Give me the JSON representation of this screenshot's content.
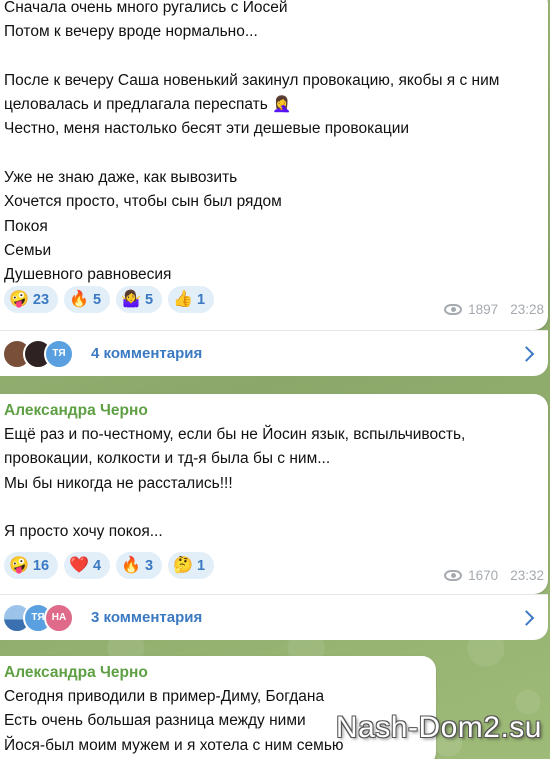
{
  "messages": [
    {
      "text": "Сначала очень много ругались с Йосей\nПотом к вечеру вроде нормально...\n\nПосле к вечеру Саша новенький закинул провокацию, якобы я с ним целовалась и предлагала переспать 🤦‍♀️\nЧестно, меня настолько бесят эти дешевые провокации\n\nУже не знаю даже, как вывозить\nХочется просто, чтобы сын был рядом\nПокоя\nСемьи\nДушевного равновесия",
      "reactions": [
        {
          "emoji": "🤪",
          "count": "23"
        },
        {
          "emoji": "🔥",
          "count": "5"
        },
        {
          "emoji": "🤷‍♀️",
          "count": "5"
        },
        {
          "emoji": "👍",
          "count": "1"
        }
      ],
      "views": "1897",
      "time": "23:28",
      "comments": {
        "label": "4 комментария",
        "avatars": [
          {
            "initials": "",
            "color": "#7a4f3a"
          },
          {
            "initials": "",
            "color": "#3a2a2a"
          },
          {
            "initials": "ТЯ",
            "color": "#5aa0e0"
          }
        ]
      }
    },
    {
      "author": "Александра Черно",
      "text": "Ещё раз и по-честному, если бы не Йосин язык, вспыльчивость, провокации, колкости и тд-я была бы с ним...\nМы бы никогда не расстались!!!\n\nЯ просто хочу покоя...",
      "reactions": [
        {
          "emoji": "🤪",
          "count": "16"
        },
        {
          "emoji": "❤️",
          "count": "4"
        },
        {
          "emoji": "🔥",
          "count": "3"
        },
        {
          "emoji": "🤔",
          "count": "1"
        }
      ],
      "views": "1670",
      "time": "23:32",
      "comments": {
        "label": "3 комментария",
        "avatars": [
          {
            "initials": "",
            "color": "#4a86c8"
          },
          {
            "initials": "ТЯ",
            "color": "#5aa0e0"
          },
          {
            "initials": "НА",
            "color": "#e06a8a"
          }
        ]
      }
    },
    {
      "author": "Александра Черно",
      "text": "Сегодня приводили в пример-Диму, Богдана\nЕсть очень большая разница между ними\nЙося-был моим мужем и я хотела с ним семью"
    }
  ],
  "watermark": "Nash-Dom2.su"
}
